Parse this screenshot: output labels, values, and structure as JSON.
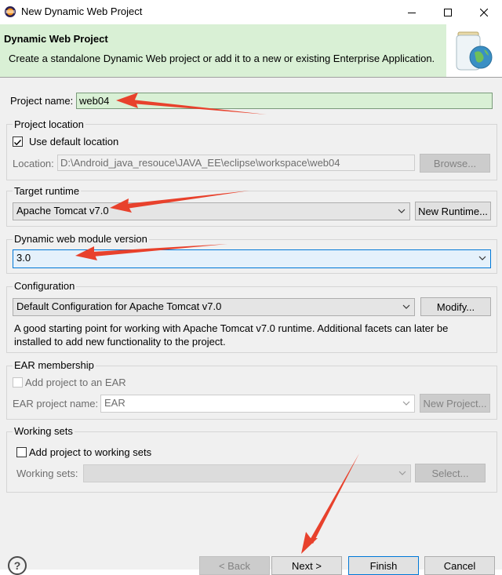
{
  "window": {
    "title": "New Dynamic Web Project"
  },
  "header": {
    "title": "Dynamic Web Project",
    "description": "Create a standalone Dynamic Web project or add it to a new or existing Enterprise Application."
  },
  "project_name": {
    "label": "Project name:",
    "value": "web04"
  },
  "project_location": {
    "group_label": "Project location",
    "use_default_label": "Use default location",
    "use_default_checked": true,
    "location_label": "Location:",
    "location_value": "D:\\Android_java_resouce\\JAVA_EE\\eclipse\\workspace\\web04",
    "browse_label": "Browse..."
  },
  "target_runtime": {
    "group_label": "Target runtime",
    "selected": "Apache Tomcat v7.0",
    "new_runtime_label": "New Runtime..."
  },
  "web_module_version": {
    "group_label": "Dynamic web module version",
    "selected": "3.0"
  },
  "configuration": {
    "group_label": "Configuration",
    "selected": "Default Configuration for Apache Tomcat v7.0",
    "modify_label": "Modify...",
    "description_line1": "A good starting point for working with Apache Tomcat v7.0 runtime. Additional facets can later be",
    "description_line2": "installed to add new functionality to the project."
  },
  "ear_membership": {
    "group_label": "EAR membership",
    "add_label": "Add project to an EAR",
    "project_name_label": "EAR project name:",
    "project_name_value": "EAR",
    "new_project_label": "New Project..."
  },
  "working_sets": {
    "group_label": "Working sets",
    "add_label": "Add project to working sets",
    "sets_label": "Working sets:",
    "select_label": "Select..."
  },
  "footer": {
    "help_symbol": "?",
    "back_label": "< Back",
    "next_label": "Next >",
    "finish_label": "Finish",
    "cancel_label": "Cancel"
  },
  "colors": {
    "header_bg": "#d9f0d5",
    "input_highlight": "#d9f0d5",
    "annotation_red": "#e8412c",
    "focus_blue": "#0078d7"
  }
}
